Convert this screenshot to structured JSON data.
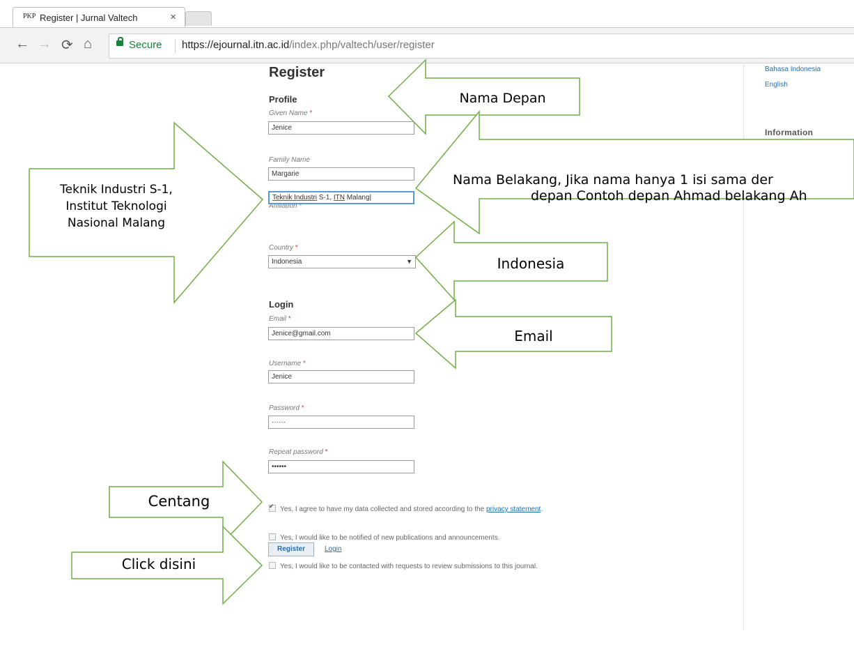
{
  "browser": {
    "tab_favicon": "PKP",
    "tab_title": "Register | Jurnal Valtech",
    "tab_close": "×",
    "secure_label": "Secure",
    "url_host": "https://ejournal.itn.ac.id",
    "url_path": "/index.php/valtech/user/register"
  },
  "sidebar": {
    "languages": [
      "Bahasa Indonesia",
      "English"
    ],
    "information_heading": "Information"
  },
  "form": {
    "title": "Register",
    "profile_heading": "Profile",
    "given_name_label": "Given Name",
    "given_name_value": "Jenice",
    "family_name_label": "Family Name",
    "family_name_value": "Margarie",
    "affiliation_label": "Affiliation",
    "affiliation_value_part1": "Teknik Industri",
    "affiliation_value_part2": "S-1,",
    "affiliation_value_part3": "ITN",
    "affiliation_value_part4": "Malang",
    "country_label": "Country",
    "country_value": "Indonesia",
    "login_heading": "Login",
    "email_label": "Email",
    "email_value": "Jenice@gmail.com",
    "username_label": "Username",
    "username_value": "Jenice",
    "password_label": "Password",
    "password_value": "······",
    "repeat_password_label": "Repeat password",
    "repeat_password_value": "••••••",
    "required_mark": "*",
    "consent_text": "Yes, I agree to have my data collected and stored according to the",
    "consent_link": "privacy statement",
    "consent_end": ".",
    "notify_text": "Yes, I would like to be notified of new publications and announcements.",
    "review_text": "Yes, I would like to be contacted with requests to review submissions to this journal.",
    "register_button": "Register",
    "login_link": "Login"
  },
  "annotations": {
    "nama_depan": "Nama Depan",
    "nama_belakang_line1": "Nama Belakang, Jika nama hanya 1 isi sama der",
    "nama_belakang_line2": "depan Contoh depan Ahmad belakang Ah",
    "affiliation_line1": "Teknik Industri S-1,",
    "affiliation_line2": "Institut Teknologi",
    "affiliation_line3": "Nasional Malang",
    "indonesia": "Indonesia",
    "email": "Email",
    "centang": "Centang",
    "click_disini": "Click disini"
  },
  "colors": {
    "annotation_stroke": "#70ad47",
    "link": "#1e6fb5",
    "secure": "#188038",
    "required": "#d04040"
  }
}
